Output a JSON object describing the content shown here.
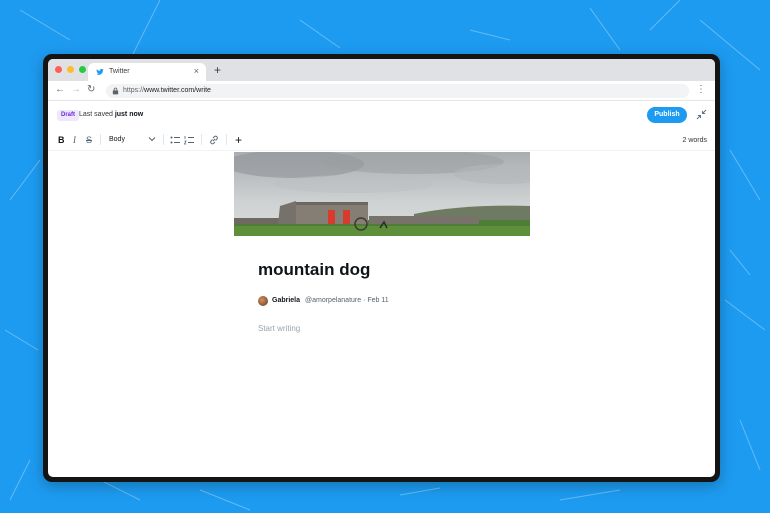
{
  "colors": {
    "background": "#1d9bf0",
    "accent": "#1d9bf0",
    "draft_badge_bg": "#efe7fb",
    "draft_badge_text": "#6d28d9",
    "traffic_red": "#ff5f57",
    "traffic_yellow": "#febc2e",
    "traffic_green": "#28c840"
  },
  "browser": {
    "tab_title": "Twitter",
    "tab_icon": "twitter-bird-icon",
    "url_protocol": "https://",
    "url_host": "www.twitter.com/write",
    "new_tab_label": "+",
    "close_label": "×"
  },
  "editor": {
    "draft_label": "Draft",
    "saved_prefix": "Last saved",
    "saved_time": "just now",
    "publish_label": "Publish",
    "style_value": "Body",
    "word_count": "2 words",
    "tools": [
      "bold-icon",
      "italic-icon",
      "strikethrough-icon",
      "bullet-list-icon",
      "numbered-list-icon",
      "link-icon",
      "plus-icon"
    ]
  },
  "article": {
    "title": "mountain dog",
    "author_name": "Gabriela",
    "author_handle": "@amorpelanature · Feb 11",
    "body_placeholder": "Start writing"
  }
}
